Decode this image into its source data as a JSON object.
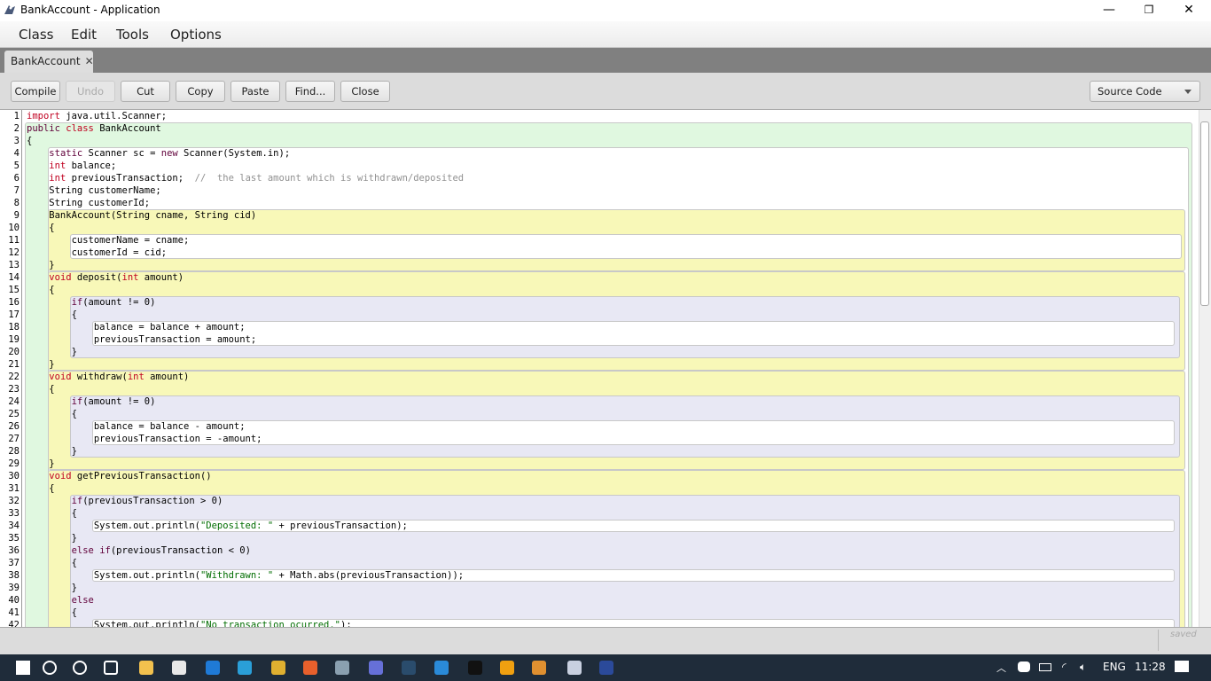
{
  "window": {
    "title": "BankAccount - Application",
    "minimize": "—",
    "maximize": "❐",
    "close": "✕"
  },
  "menu": [
    "Class",
    "Edit",
    "Tools",
    "Options"
  ],
  "tab": {
    "label": "BankAccount",
    "close": "✕"
  },
  "toolbar": {
    "buttons": [
      {
        "label": "Compile",
        "enabled": true
      },
      {
        "label": "Undo",
        "enabled": false
      },
      {
        "label": "Cut",
        "enabled": true
      },
      {
        "label": "Copy",
        "enabled": true
      },
      {
        "label": "Paste",
        "enabled": true
      },
      {
        "label": "Find...",
        "enabled": true
      },
      {
        "label": "Close",
        "enabled": true
      }
    ],
    "view_select": "Source Code"
  },
  "code": {
    "first_line_number": 1,
    "keywords_red": [
      "import",
      "class",
      "int",
      "void"
    ],
    "keywords_purple": [
      "public",
      "static",
      "new",
      "if",
      "else"
    ],
    "colors": {
      "keyword_red": "#c00020",
      "keyword_purple": "#60003a",
      "string": "#006d00",
      "comment": "#909090",
      "class_scope": "#e0f8e0",
      "method_scope": "#f8f8b8",
      "if_scope": "#e8e8f4"
    },
    "lines": [
      "import java.util.Scanner;",
      "public class BankAccount",
      "{",
      "    static Scanner sc = new Scanner(System.in);",
      "    int balance;",
      "    int previousTransaction;  //  the last amount which is withdrawn/deposited",
      "    String customerName;",
      "    String customerId;",
      "    BankAccount(String cname, String cid)",
      "    {",
      "        customerName = cname;",
      "        customerId = cid;",
      "    }",
      "    void deposit(int amount)",
      "    {",
      "        if(amount != 0)",
      "        {",
      "            balance = balance + amount;",
      "            previousTransaction = amount;",
      "        }",
      "    }",
      "    void withdraw(int amount)",
      "    {",
      "        if(amount != 0)",
      "        {",
      "            balance = balance - amount;",
      "            previousTransaction = -amount;",
      "        }",
      "    }",
      "    void getPreviousTransaction()",
      "    {",
      "        if(previousTransaction > 0)",
      "        {",
      "            System.out.println(\"Deposited: \" + previousTransaction);",
      "        }",
      "        else if(previousTransaction < 0)",
      "        {",
      "            System.out.println(\"Withdrawn: \" + Math.abs(previousTransaction));",
      "        }",
      "        else",
      "        {",
      "            System.out.println(\"No transaction ocurred.\");"
    ]
  },
  "status": {
    "saved": "saved"
  },
  "taskbar": {
    "apps": [
      {
        "icon": "windows-start-icon"
      },
      {
        "icon": "search-icon"
      },
      {
        "icon": "cortana-icon"
      },
      {
        "icon": "task-view-icon"
      },
      {
        "icon": "file-explorer-icon",
        "color": "#f2c14e"
      },
      {
        "icon": "microsoft-store-icon",
        "color": "#e8e8e8"
      },
      {
        "icon": "whatsapp-icon",
        "color": "#1f7ad6"
      },
      {
        "icon": "edge-icon",
        "color": "#2a9fd8"
      },
      {
        "icon": "chrome-icon",
        "color": "#e0b030"
      },
      {
        "icon": "firefox-icon",
        "color": "#e8602c"
      },
      {
        "icon": "task-manager-icon",
        "color": "#8aa0b0"
      },
      {
        "icon": "discord-icon",
        "color": "#6670d8"
      },
      {
        "icon": "steam-icon",
        "color": "#2a4c6c"
      },
      {
        "icon": "app-icon",
        "color": "#2a8ad8"
      },
      {
        "icon": "epic-games-icon",
        "color": "#111111"
      },
      {
        "icon": "rockstar-icon",
        "color": "#f0a010"
      },
      {
        "icon": "app2-icon",
        "color": "#e09030"
      },
      {
        "icon": "bluej-icon",
        "color": "#c8d0e0"
      },
      {
        "icon": "word-icon",
        "color": "#2b4a9a"
      }
    ],
    "language": "ENG",
    "time": "11:28"
  }
}
